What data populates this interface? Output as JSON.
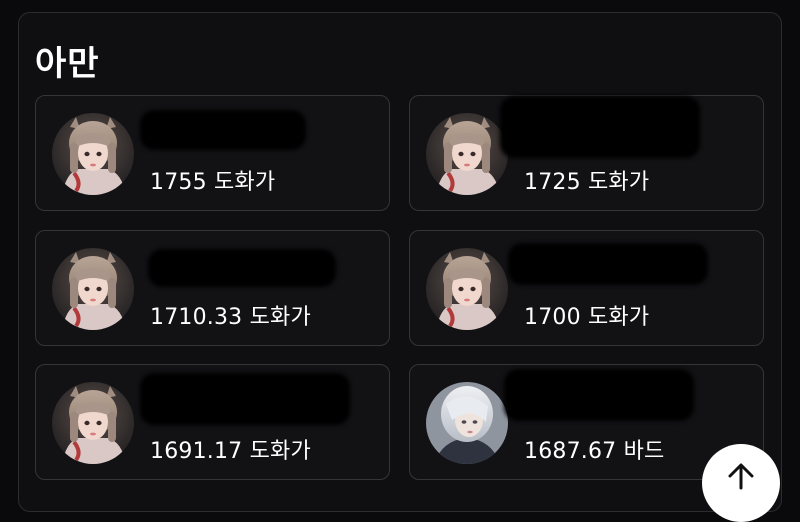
{
  "section": {
    "title": "아만"
  },
  "cards": [
    {
      "score": "1755 도화가",
      "avatar": "doga-avatar"
    },
    {
      "score": "1725 도화가",
      "avatar": "doga-avatar"
    },
    {
      "score": "1710.33 도화가",
      "avatar": "doga-avatar"
    },
    {
      "score": "1700 도화가",
      "avatar": "doga-avatar"
    },
    {
      "score": "1691.17 도화가",
      "avatar": "doga-avatar"
    },
    {
      "score": "1687.67 바드",
      "avatar": "bard-avatar"
    }
  ],
  "scroll_top": {
    "icon": "arrow-up-icon"
  }
}
